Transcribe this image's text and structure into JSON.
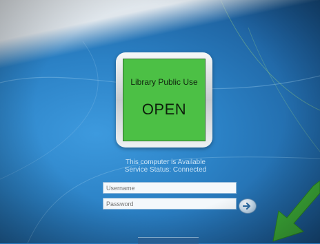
{
  "tile": {
    "title": "Library Public Use",
    "status": "OPEN",
    "color": "#4cc045"
  },
  "status": {
    "availability": "This computer is Available",
    "service": "Service Status: Connected"
  },
  "login": {
    "username_placeholder": "Username",
    "password_placeholder": "Password",
    "submit_icon": "arrow-right-icon"
  },
  "overlay": {
    "pointer_icon": "green-arrow-icon",
    "pointer_color": "#3fb23a"
  }
}
